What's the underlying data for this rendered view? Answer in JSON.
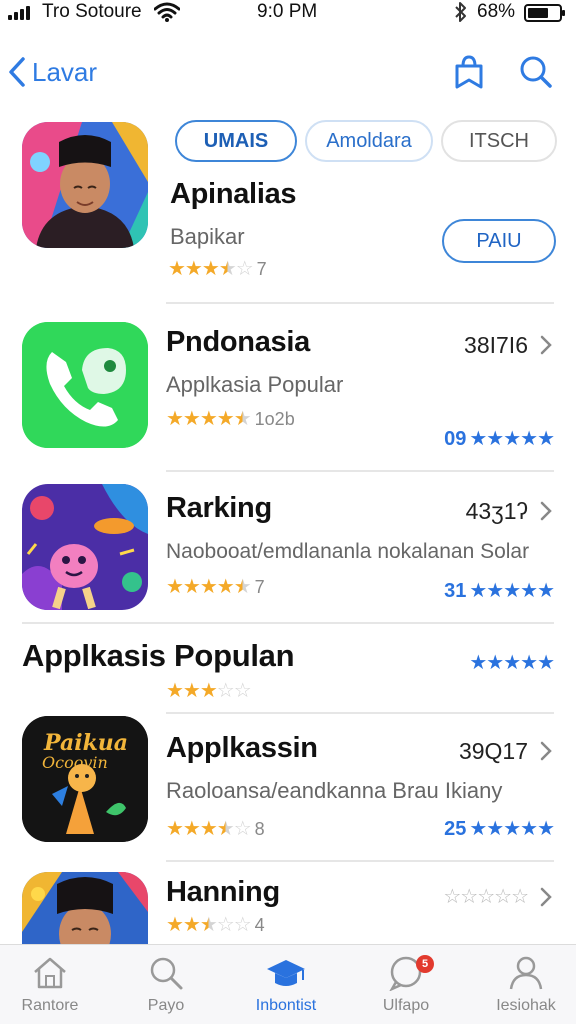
{
  "status_bar": {
    "carrier": "Tro Sotoure",
    "time": "9:0 PM",
    "battery_text": "68%",
    "battery_level": 0.68
  },
  "nav": {
    "back_label": "Lavar"
  },
  "featured": {
    "tabs": [
      {
        "label": "UMAIS",
        "active": true
      },
      {
        "label": "Amoldara",
        "active": false
      },
      {
        "label": "ITSCH",
        "active": false
      }
    ],
    "title": "Apinalias",
    "subtitle": "Bapikar",
    "rating": 3.5,
    "rating_count": "7",
    "get_label": "PAIU"
  },
  "apps": [
    {
      "title": "Pndonasia",
      "subtitle": "Applkasia Popular",
      "rating": 4.5,
      "rating_count": "1o2b",
      "number": "38I7I6",
      "blue_value": "09",
      "blue_stars": 5
    },
    {
      "title": "Rarking",
      "subtitle": "Naobooat/emdlananla nokalanan Solar",
      "rating": 4.5,
      "rating_count": "7",
      "number": "43ʒ1ʔ",
      "blue_value": "31",
      "blue_stars": 5
    }
  ],
  "section": {
    "title": "Applkasis Populan",
    "rating": 3,
    "blue_stars": 5
  },
  "apps2": [
    {
      "title": "Applkassin",
      "subtitle": "Raoloansa/eandkanna Brau Ikiany",
      "rating": 3.5,
      "rating_count": "8",
      "number": "39Q17",
      "blue_value": "25",
      "blue_stars": 5
    },
    {
      "title": "Hanning",
      "rating": 2.5,
      "rating_count": "4",
      "outline_stars": 5
    }
  ],
  "tab_bar": {
    "items": [
      {
        "label": "Rantore",
        "icon": "home-icon",
        "active": false
      },
      {
        "label": "Payo",
        "icon": "search-icon",
        "active": false
      },
      {
        "label": "Inbontist",
        "icon": "graduation-cap-icon",
        "active": true
      },
      {
        "label": "Ulfapo",
        "icon": "chat-bubble-icon",
        "active": false,
        "badge": "5"
      },
      {
        "label": "Iesiohak",
        "icon": "person-icon",
        "active": false
      }
    ]
  },
  "colors": {
    "accent": "#2f7be2",
    "star": "#f4a928",
    "badge": "#e23a2e",
    "phone_app": "#30d85a"
  }
}
